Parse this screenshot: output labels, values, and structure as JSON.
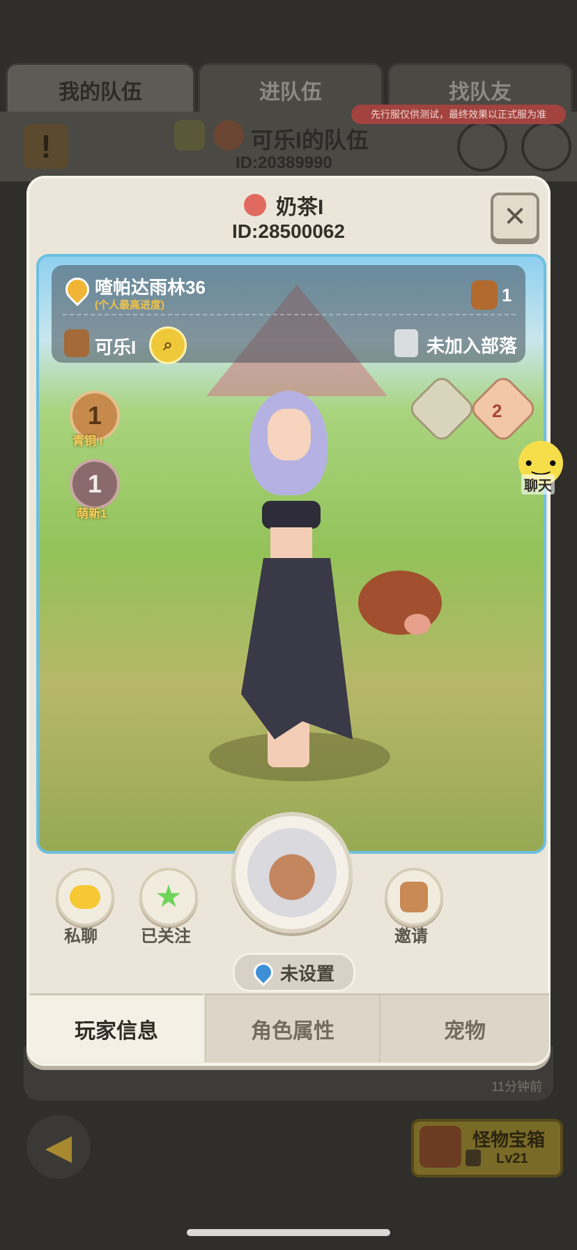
{
  "background": {
    "tabs": [
      "我的队伍",
      "进队伍",
      "找队友"
    ],
    "team_name": "可乐I的队伍",
    "team_id": "ID:20389990",
    "notice": "先行服仅供测试，最终效果以正式服为准",
    "list_time": "11分钟前",
    "chest": {
      "title": "怪物宝箱",
      "level": "Lv21"
    }
  },
  "profile": {
    "name": "奶茶I",
    "id": "ID:28500062",
    "location": "喳帕达雨林36",
    "location_note": "(个人最高进度)",
    "friend_count": "1",
    "friend_name": "可乐I",
    "tribe": "未加入部落",
    "badge_level": "2",
    "ranks": [
      {
        "number": "1",
        "label": "青铜 I"
      },
      {
        "number": "1",
        "label": "萌新1"
      }
    ],
    "chat_float_label": "聊天"
  },
  "actions": {
    "private_chat": "私聊",
    "followed": "已关注",
    "invite": "邀请",
    "location_status": "未设置"
  },
  "bottom_tabs": [
    "玩家信息",
    "角色属性",
    "宠物"
  ],
  "icons": {
    "close": "close-icon",
    "search": "search-icon",
    "chat": "chat-bubble-icon",
    "star": "star-icon",
    "invite": "add-friend-icon",
    "pin": "location-pin-icon",
    "back": "back-arrow-icon"
  },
  "colors": {
    "accent_gold": "#f0b534",
    "star_green": "#6fd35a",
    "notice_red": "#a2433f"
  }
}
